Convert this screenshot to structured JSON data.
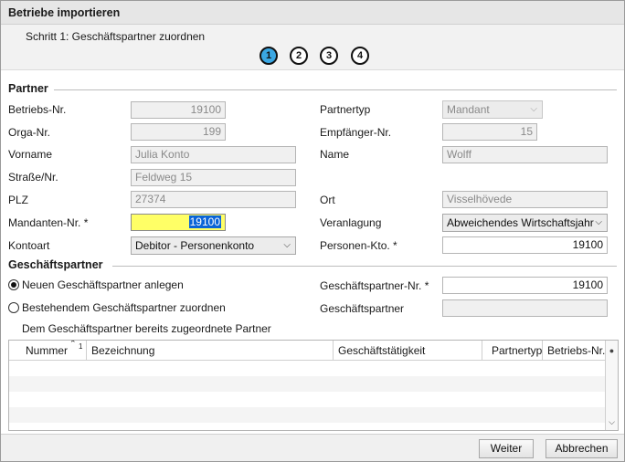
{
  "window": {
    "title": "Betriebe importieren"
  },
  "steps": {
    "text": "Schritt 1: Geschäftspartner zuordnen",
    "items": [
      "1",
      "2",
      "3",
      "4"
    ],
    "active_color": "#3aa7e3"
  },
  "partner": {
    "heading": "Partner",
    "betriebs_nr": {
      "label": "Betriebs-Nr.",
      "value": "19100"
    },
    "orga_nr": {
      "label": "Orga-Nr.",
      "value": "199"
    },
    "vorname": {
      "label": "Vorname",
      "value": "Julia Konto"
    },
    "strasse": {
      "label": "Straße/Nr.",
      "value": "Feldweg 15"
    },
    "plz": {
      "label": "PLZ",
      "value": "27374"
    },
    "mandanten_nr": {
      "label": "Mandanten-Nr. *",
      "value": "19100",
      "highlight_color": "#ffff66"
    },
    "kontoart": {
      "label": "Kontoart",
      "value": "Debitor - Personenkonto"
    },
    "partnertyp": {
      "label": "Partnertyp",
      "value": "Mandant"
    },
    "empfaenger_nr": {
      "label": "Empfänger-Nr.",
      "value": "15"
    },
    "name": {
      "label": "Name",
      "value": "Wolff"
    },
    "ort": {
      "label": "Ort",
      "value": "Visselhövede"
    },
    "veranlagung": {
      "label": "Veranlagung",
      "value": "Abweichendes Wirtschaftsjahr"
    },
    "personen_kto": {
      "label": "Personen-Kto. *",
      "value": "19100"
    }
  },
  "gp": {
    "heading": "Geschäftspartner",
    "radio_new": "Neuen Geschäftspartner anlegen",
    "radio_existing": "Bestehendem Geschäftspartner zuordnen",
    "gp_nr": {
      "label": "Geschäftspartner-Nr. *",
      "value": "19100"
    },
    "gp": {
      "label": "Geschäftspartner",
      "value": ""
    },
    "assigned_note": "Dem Geschäftspartner bereits zugeordnete Partner"
  },
  "table": {
    "columns": [
      "Nummer",
      "Bezeichnung",
      "Geschäftstätigkeit",
      "Partnertyp",
      "Betriebs-Nr."
    ],
    "sort_indicator": "1",
    "rows": []
  },
  "footer": {
    "next_label": "Weiter",
    "cancel_label": "Abbrechen"
  }
}
